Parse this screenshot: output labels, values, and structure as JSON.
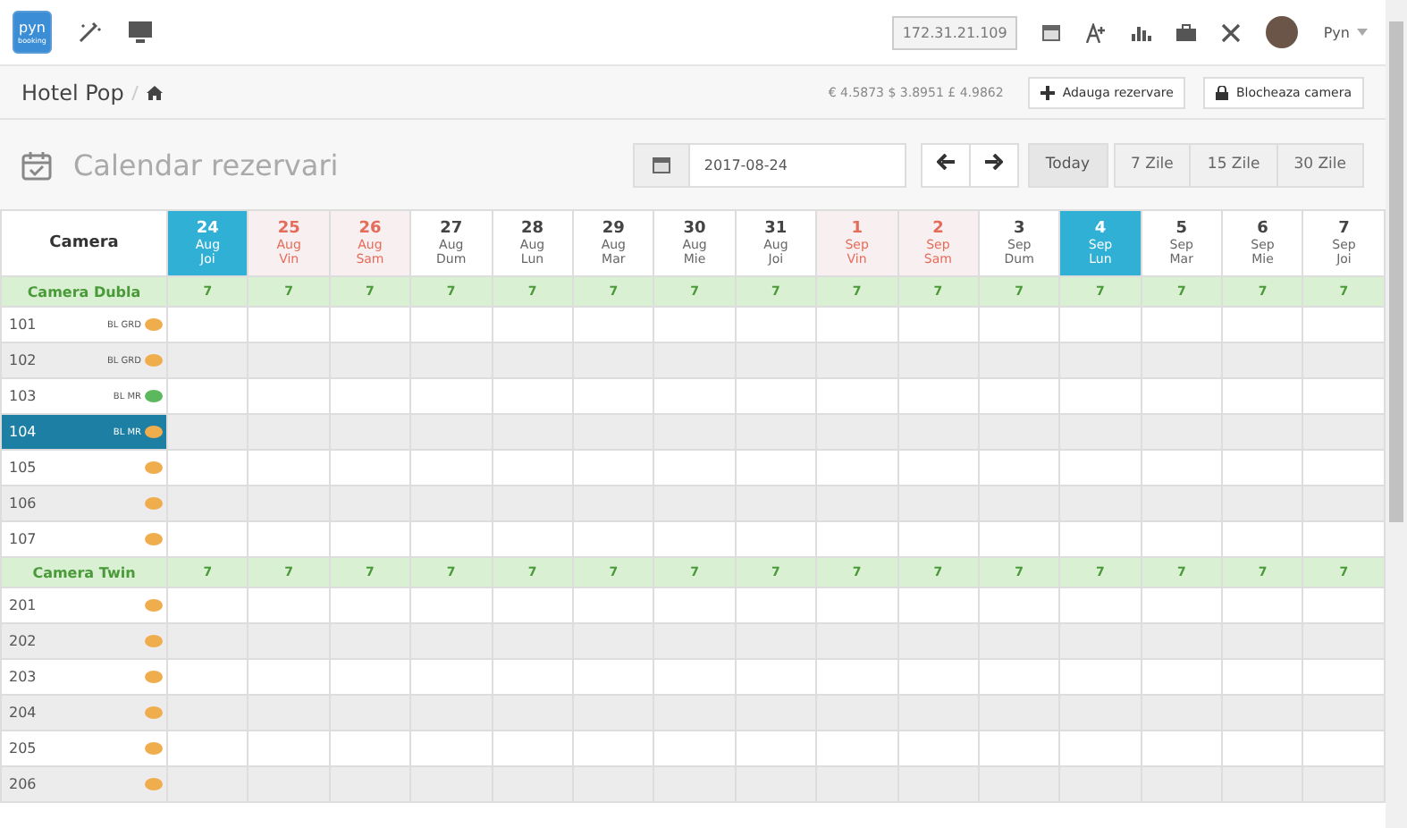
{
  "topbar": {
    "logo_text": "pyn",
    "logo_subtext": "booking",
    "ip": "172.31.21.109",
    "user": "Pyn"
  },
  "breadcrumb": {
    "hotel": "Hotel Pop"
  },
  "rates": "€ 4.5873 $ 3.8951 £ 4.9862",
  "actions": [
    "Adauga rezervare",
    "Blocheaza camera"
  ],
  "page_title": "Calendar rezervari",
  "date_field": {
    "value": "2017-08-24"
  },
  "range_buttons": [
    {
      "label": "Today",
      "selected": true
    },
    {
      "label": "7 Zile",
      "selected": false
    },
    {
      "label": "15 Zile",
      "selected": false
    },
    {
      "label": "30 Zile",
      "selected": false
    }
  ],
  "table": {
    "corner": "Camera",
    "days": [
      {
        "day": "24",
        "month": "Aug",
        "weekday": "Joi",
        "kind": "current"
      },
      {
        "day": "25",
        "month": "Aug",
        "weekday": "Vin",
        "kind": "weekend"
      },
      {
        "day": "26",
        "month": "Aug",
        "weekday": "Sam",
        "kind": "weekend"
      },
      {
        "day": "27",
        "month": "Aug",
        "weekday": "Dum",
        "kind": "normal"
      },
      {
        "day": "28",
        "month": "Aug",
        "weekday": "Lun",
        "kind": "normal"
      },
      {
        "day": "29",
        "month": "Aug",
        "weekday": "Mar",
        "kind": "normal"
      },
      {
        "day": "30",
        "month": "Aug",
        "weekday": "Mie",
        "kind": "normal"
      },
      {
        "day": "31",
        "month": "Aug",
        "weekday": "Joi",
        "kind": "normal"
      },
      {
        "day": "1",
        "month": "Sep",
        "weekday": "Vin",
        "kind": "weekend"
      },
      {
        "day": "2",
        "month": "Sep",
        "weekday": "Sam",
        "kind": "weekend"
      },
      {
        "day": "3",
        "month": "Sep",
        "weekday": "Dum",
        "kind": "normal"
      },
      {
        "day": "4",
        "month": "Sep",
        "weekday": "Lun",
        "kind": "current"
      },
      {
        "day": "5",
        "month": "Sep",
        "weekday": "Mar",
        "kind": "normal"
      },
      {
        "day": "6",
        "month": "Sep",
        "weekday": "Mie",
        "kind": "normal"
      },
      {
        "day": "7",
        "month": "Sep",
        "weekday": "Joi",
        "kind": "normal"
      }
    ],
    "groups": [
      {
        "name": "Camera Dubla",
        "counts": [
          "7",
          "7",
          "7",
          "7",
          "7",
          "7",
          "7",
          "7",
          "7",
          "7",
          "7",
          "7",
          "7",
          "7",
          "7"
        ],
        "rooms": [
          {
            "number": "101",
            "tags": "BL GRD",
            "color": "#f0ad4e",
            "selected": false
          },
          {
            "number": "102",
            "tags": "BL GRD",
            "color": "#f0ad4e",
            "selected": false
          },
          {
            "number": "103",
            "tags": "BL MR",
            "color": "#5cb85c",
            "selected": false
          },
          {
            "number": "104",
            "tags": "BL MR",
            "color": "#f0ad4e",
            "selected": true
          },
          {
            "number": "105",
            "color": "#f0ad4e",
            "selected": false
          },
          {
            "number": "106",
            "color": "#f0ad4e",
            "selected": false
          },
          {
            "number": "107",
            "color": "#f0ad4e",
            "selected": false
          }
        ]
      },
      {
        "name": "Camera Twin",
        "counts": [
          "7",
          "7",
          "7",
          "7",
          "7",
          "7",
          "7",
          "7",
          "7",
          "7",
          "7",
          "7",
          "7",
          "7",
          "7"
        ],
        "rooms": [
          {
            "number": "201",
            "color": "#f0ad4e",
            "selected": false
          },
          {
            "number": "202",
            "color": "#f0ad4e",
            "selected": false
          },
          {
            "number": "203",
            "color": "#f0ad4e",
            "selected": false
          },
          {
            "number": "204",
            "color": "#f0ad4e",
            "selected": false
          },
          {
            "number": "205",
            "color": "#f0ad4e",
            "selected": false
          },
          {
            "number": "206",
            "color": "#f0ad4e",
            "selected": false
          }
        ]
      }
    ]
  }
}
